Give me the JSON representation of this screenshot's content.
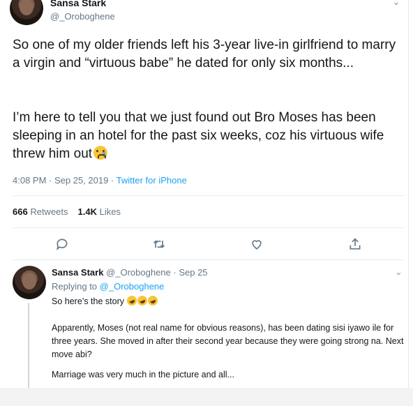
{
  "colors": {
    "accent": "#1da1f2",
    "muted": "#657786",
    "text": "#14171a",
    "divider": "#e6ecf0"
  },
  "main_tweet": {
    "display_name": "Sansa Stark",
    "handle": "@_Oroboghene",
    "paragraph1": "So one of my older friends left his 3-year live-in girlfriend to marry a virgin and “virtuous babe” he dated for only six months...",
    "paragraph2": "I’m here to tell you that we just found out Bro Moses has been sleeping in an hotel for the past six weeks, coz his virtuous wife threw him out",
    "emoji": "crying-face-emoji",
    "timestamp": "4:08 PM · Sep 25, 2019 · ",
    "source": "Twitter for iPhone",
    "retweets_count": "666",
    "retweets_label": "Retweets",
    "likes_count": "1.4K",
    "likes_label": "Likes",
    "actions": [
      "reply-icon",
      "retweet-icon",
      "like-icon",
      "share-icon"
    ]
  },
  "reply_tweet": {
    "display_name": "Sansa Stark",
    "handle_date": "@_Oroboghene · Sep 25",
    "replying_prefix": "Replying to",
    "replying_handle": "@_Oroboghene",
    "line1": "So here’s the story",
    "emojis": [
      "rolling-laughing-emoji",
      "rolling-laughing-emoji",
      "rolling-laughing-emoji"
    ],
    "line2": "Apparently, Moses (not real name for obvious reasons), has been dating sisi iyawo ile for three years. She moved in after their second year because they were going strong na. Next move abi?",
    "line3": "Marriage was very much in the picture and all..."
  }
}
